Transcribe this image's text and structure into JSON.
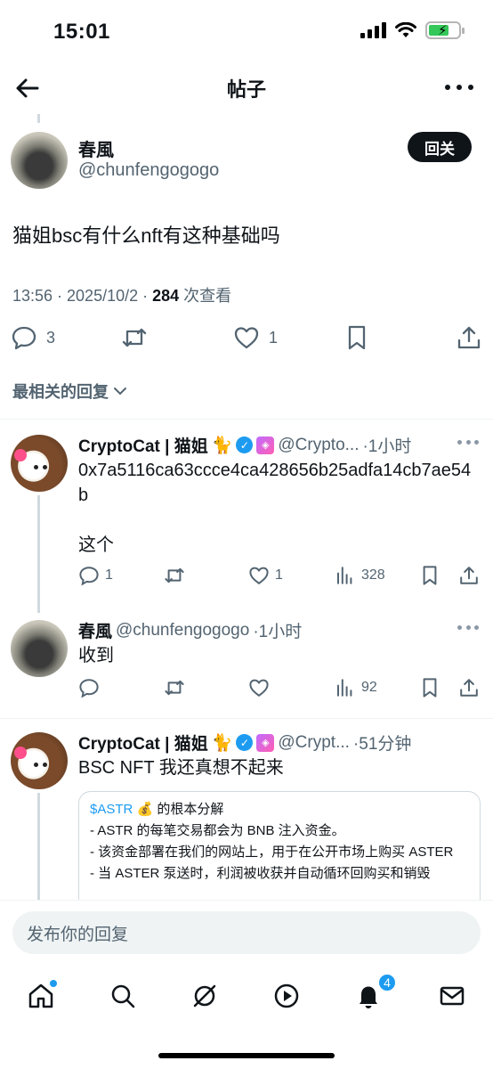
{
  "status_bar": {
    "time": "15:01"
  },
  "header": {
    "title": "帖子"
  },
  "main_post": {
    "display_name": "春風",
    "handle": "@chunfengogogo",
    "follow_label": "回关",
    "text": "猫姐bsc有什么nft有这种基础吗",
    "meta_prefix": "13:56 · 2025/10/2 · ",
    "views_count": "284",
    "views_label": " 次查看",
    "reply_count": "3",
    "like_count": "1"
  },
  "sort": {
    "label": "最相关的回复"
  },
  "replies": [
    {
      "display_name": "CryptoCat | 猫姐",
      "emoji": "🐈",
      "handle": "@Crypto...",
      "time": "·1小时",
      "text": "0x7a5116ca63ccce4ca428656b25adfa14cb7ae54b\n\n这个",
      "reply_count": "1",
      "like_count": "1",
      "view_count": "328"
    },
    {
      "display_name": "春風",
      "handle": "@chunfengogogo",
      "time": "·1小时",
      "text": "收到",
      "view_count": "92"
    },
    {
      "display_name": "CryptoCat | 猫姐",
      "emoji": "🐈",
      "handle": "@Crypt...",
      "time": "·51分钟",
      "text": "BSC NFT 我还真想不起来",
      "quote": {
        "cashtag": "$ASTR",
        "money_emoji": "💰",
        "title_rest": " 的根本分解",
        "lines": [
          "- ASTR 的每笔交易都会为 BNB 注入资金。",
          "- 该资金部署在我们的网站上，用于在公开市场上购买 ASTER",
          "- 当 ASTER 泵送时，利润被收获并自动循环回购买和销毁"
        ]
      }
    }
  ],
  "compose": {
    "placeholder": "发布你的回复"
  },
  "tabbar": {
    "notification_badge": "4"
  }
}
